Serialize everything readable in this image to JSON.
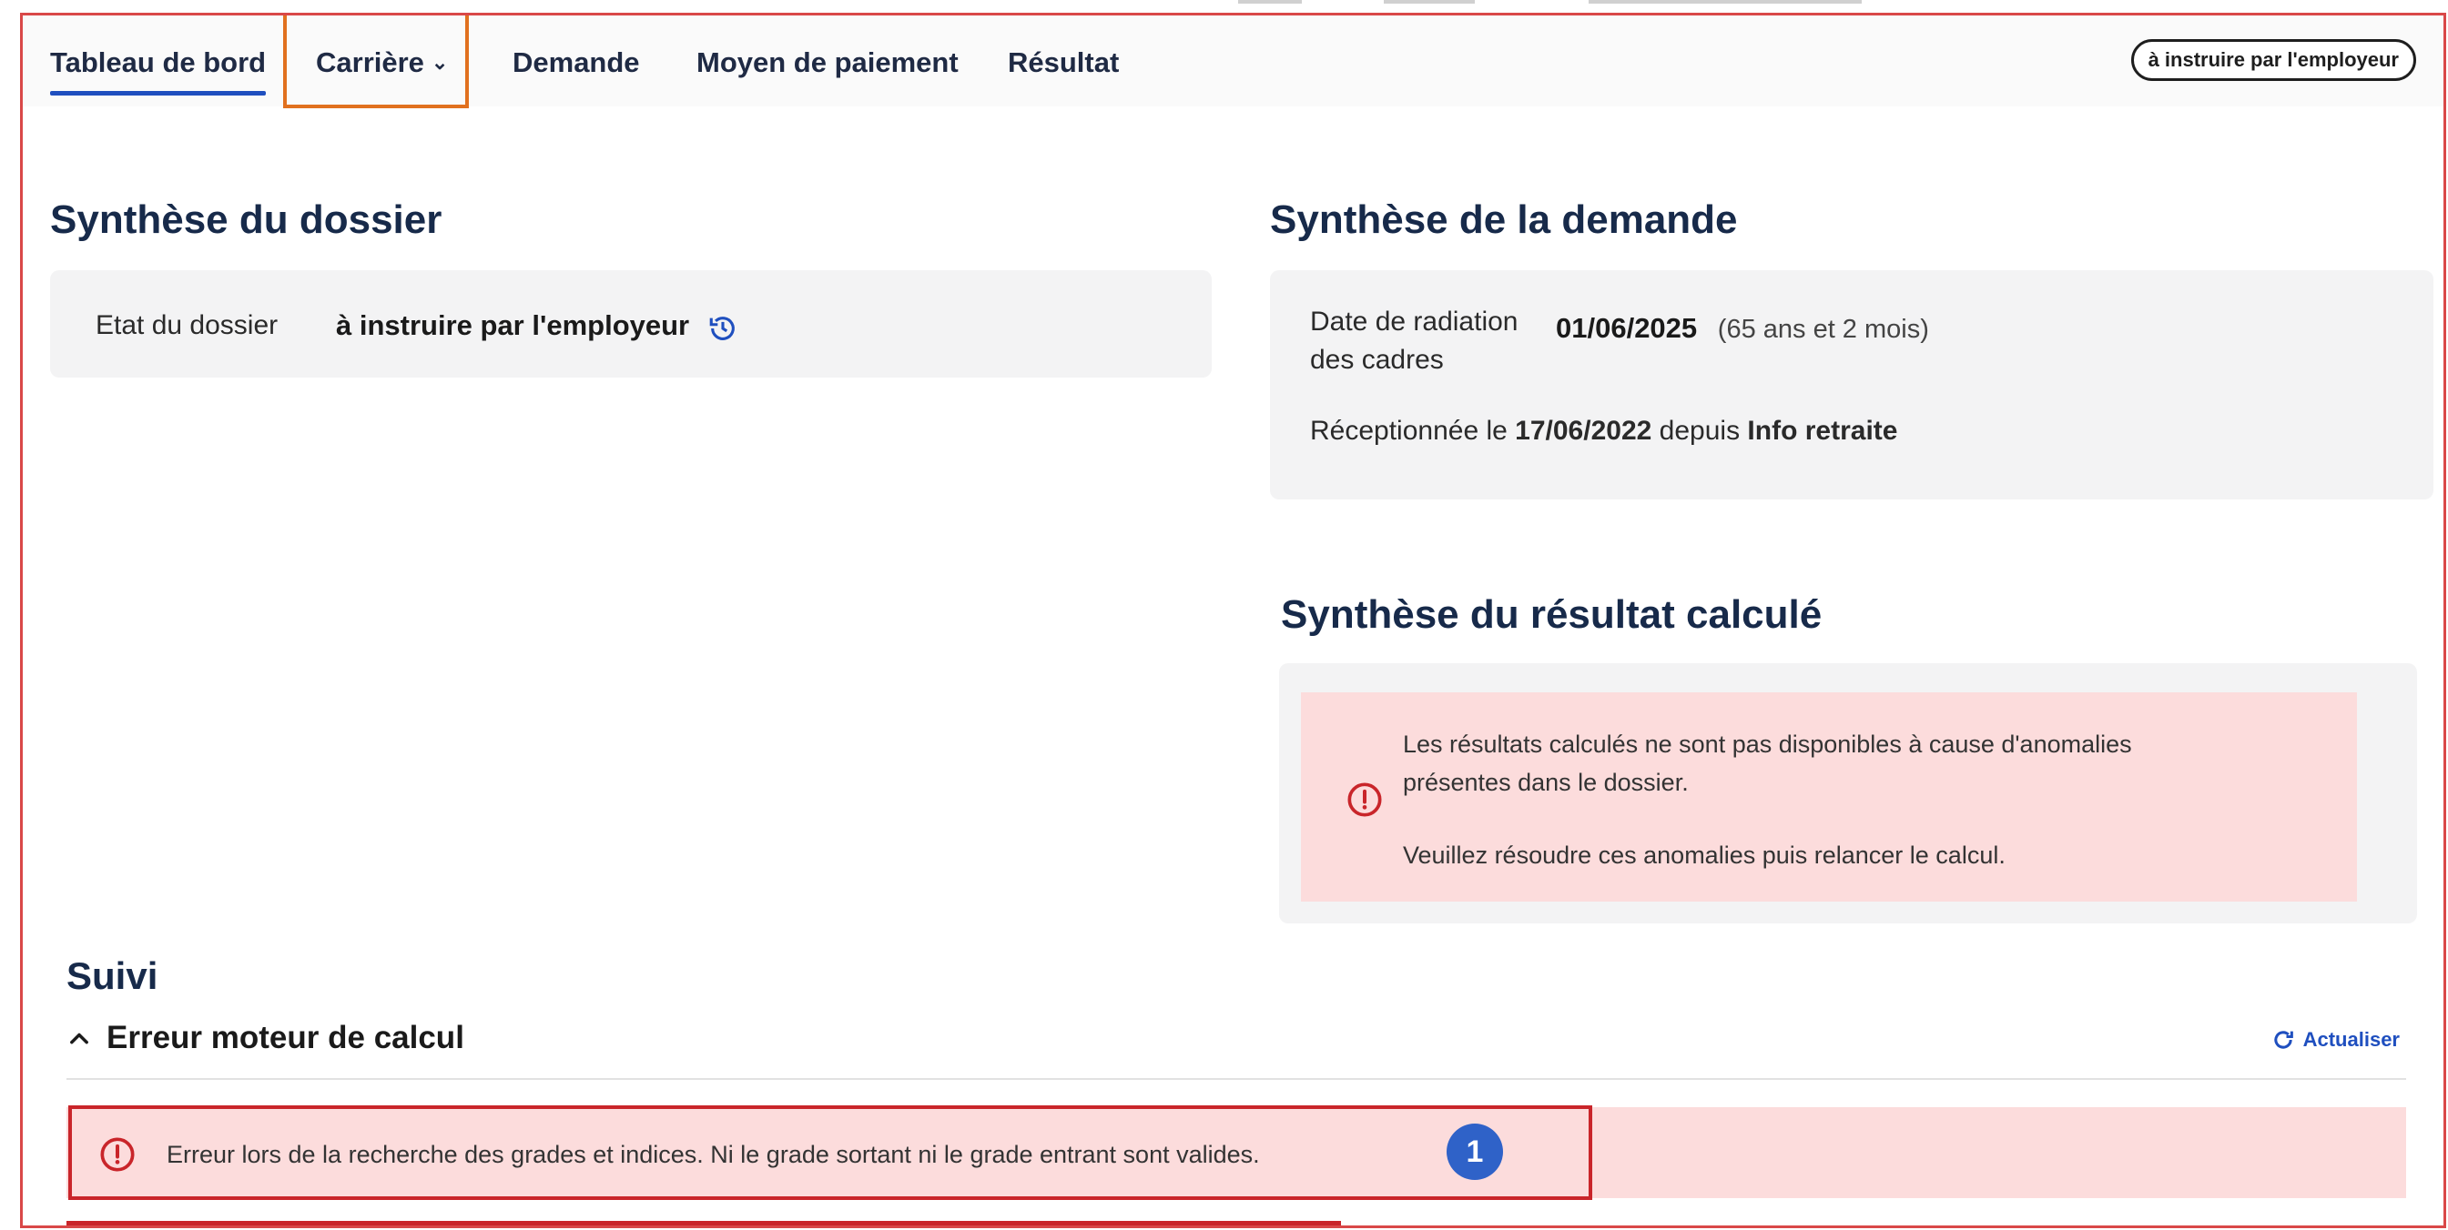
{
  "nav": {
    "tabs": [
      {
        "label": "Tableau de bord"
      },
      {
        "label": "Carrière"
      },
      {
        "label": "Demande"
      },
      {
        "label": "Moyen de paiement"
      },
      {
        "label": "Résultat"
      }
    ],
    "status_pill": "à instruire par l'employeur"
  },
  "dossier": {
    "title": "Synthèse du dossier",
    "etat_label": "Etat du dossier",
    "etat_value": "à instruire par l'employeur"
  },
  "demande": {
    "title": "Synthèse de la demande",
    "radiation_label_1": "Date de radiation",
    "radiation_label_2": "des cadres",
    "radiation_date": "01/06/2025",
    "radiation_age": "(65 ans et 2 mois)",
    "reception_prefix": "Réceptionnée le",
    "reception_date": "17/06/2022",
    "reception_mid": "depuis",
    "reception_source": "Info retraite"
  },
  "resultat": {
    "title": "Synthèse du résultat calculé",
    "alert_line1": "Les résultats calculés ne sont pas disponibles à cause d'anomalies",
    "alert_line2": "présentes dans le dossier.",
    "alert_line3": "Veuillez résoudre ces anomalies puis relancer le calcul."
  },
  "suivi": {
    "title": "Suivi",
    "accordion_title": "Erreur moteur de calcul",
    "refresh_label": "Actualiser",
    "error_text": "Erreur lors de la recherche des grades et indices. Ni le grade sortant ni le grade entrant sont valides.",
    "badge": "1"
  },
  "colors": {
    "frame_border": "#d94848",
    "nav_highlight": "#e1711f",
    "accent_blue": "#1f4fbf",
    "alert_bg": "#fcdcdc",
    "error_border": "#c9252a"
  },
  "icons": [
    "history-icon",
    "alert-circle-icon",
    "chevron-up-icon",
    "refresh-icon",
    "chevron-down-icon"
  ]
}
